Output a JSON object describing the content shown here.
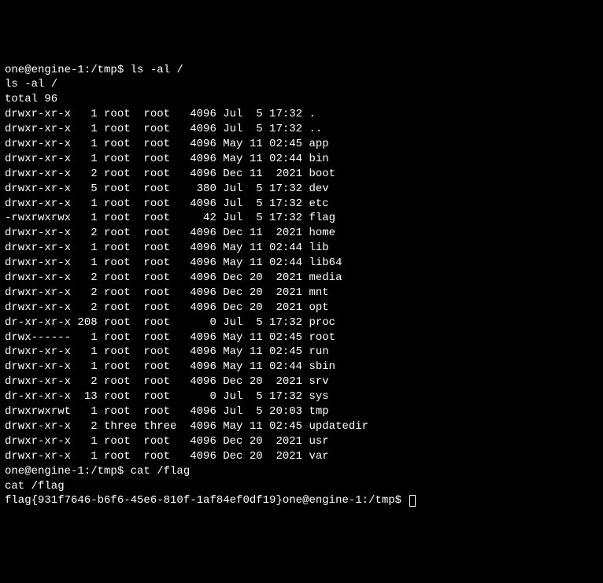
{
  "prompt1": "one@engine-1:/tmp$ ls -al /",
  "echo1": "ls -al /",
  "total_line": "total 96",
  "entries": [
    {
      "perm": "drwxr-xr-x",
      "links": "1",
      "owner": "root",
      "group": "root",
      "size": "4096",
      "month": "Jul",
      "day": "5",
      "time": "17:32",
      "name": "."
    },
    {
      "perm": "drwxr-xr-x",
      "links": "1",
      "owner": "root",
      "group": "root",
      "size": "4096",
      "month": "Jul",
      "day": "5",
      "time": "17:32",
      "name": ".."
    },
    {
      "perm": "drwxr-xr-x",
      "links": "1",
      "owner": "root",
      "group": "root",
      "size": "4096",
      "month": "May",
      "day": "11",
      "time": "02:45",
      "name": "app"
    },
    {
      "perm": "drwxr-xr-x",
      "links": "1",
      "owner": "root",
      "group": "root",
      "size": "4096",
      "month": "May",
      "day": "11",
      "time": "02:44",
      "name": "bin"
    },
    {
      "perm": "drwxr-xr-x",
      "links": "2",
      "owner": "root",
      "group": "root",
      "size": "4096",
      "month": "Dec",
      "day": "11",
      "time": "2021",
      "name": "boot"
    },
    {
      "perm": "drwxr-xr-x",
      "links": "5",
      "owner": "root",
      "group": "root",
      "size": "380",
      "month": "Jul",
      "day": "5",
      "time": "17:32",
      "name": "dev"
    },
    {
      "perm": "drwxr-xr-x",
      "links": "1",
      "owner": "root",
      "group": "root",
      "size": "4096",
      "month": "Jul",
      "day": "5",
      "time": "17:32",
      "name": "etc"
    },
    {
      "perm": "-rwxrwxrwx",
      "links": "1",
      "owner": "root",
      "group": "root",
      "size": "42",
      "month": "Jul",
      "day": "5",
      "time": "17:32",
      "name": "flag"
    },
    {
      "perm": "drwxr-xr-x",
      "links": "2",
      "owner": "root",
      "group": "root",
      "size": "4096",
      "month": "Dec",
      "day": "11",
      "time": "2021",
      "name": "home"
    },
    {
      "perm": "drwxr-xr-x",
      "links": "1",
      "owner": "root",
      "group": "root",
      "size": "4096",
      "month": "May",
      "day": "11",
      "time": "02:44",
      "name": "lib"
    },
    {
      "perm": "drwxr-xr-x",
      "links": "1",
      "owner": "root",
      "group": "root",
      "size": "4096",
      "month": "May",
      "day": "11",
      "time": "02:44",
      "name": "lib64"
    },
    {
      "perm": "drwxr-xr-x",
      "links": "2",
      "owner": "root",
      "group": "root",
      "size": "4096",
      "month": "Dec",
      "day": "20",
      "time": "2021",
      "name": "media"
    },
    {
      "perm": "drwxr-xr-x",
      "links": "2",
      "owner": "root",
      "group": "root",
      "size": "4096",
      "month": "Dec",
      "day": "20",
      "time": "2021",
      "name": "mnt"
    },
    {
      "perm": "drwxr-xr-x",
      "links": "2",
      "owner": "root",
      "group": "root",
      "size": "4096",
      "month": "Dec",
      "day": "20",
      "time": "2021",
      "name": "opt"
    },
    {
      "perm": "dr-xr-xr-x",
      "links": "208",
      "owner": "root",
      "group": "root",
      "size": "0",
      "month": "Jul",
      "day": "5",
      "time": "17:32",
      "name": "proc"
    },
    {
      "perm": "drwx------",
      "links": "1",
      "owner": "root",
      "group": "root",
      "size": "4096",
      "month": "May",
      "day": "11",
      "time": "02:45",
      "name": "root"
    },
    {
      "perm": "drwxr-xr-x",
      "links": "1",
      "owner": "root",
      "group": "root",
      "size": "4096",
      "month": "May",
      "day": "11",
      "time": "02:45",
      "name": "run"
    },
    {
      "perm": "drwxr-xr-x",
      "links": "1",
      "owner": "root",
      "group": "root",
      "size": "4096",
      "month": "May",
      "day": "11",
      "time": "02:44",
      "name": "sbin"
    },
    {
      "perm": "drwxr-xr-x",
      "links": "2",
      "owner": "root",
      "group": "root",
      "size": "4096",
      "month": "Dec",
      "day": "20",
      "time": "2021",
      "name": "srv"
    },
    {
      "perm": "dr-xr-xr-x",
      "links": "13",
      "owner": "root",
      "group": "root",
      "size": "0",
      "month": "Jul",
      "day": "5",
      "time": "17:32",
      "name": "sys"
    },
    {
      "perm": "drwxrwxrwt",
      "links": "1",
      "owner": "root",
      "group": "root",
      "size": "4096",
      "month": "Jul",
      "day": "5",
      "time": "20:03",
      "name": "tmp"
    },
    {
      "perm": "drwxr-xr-x",
      "links": "2",
      "owner": "three",
      "group": "three",
      "size": "4096",
      "month": "May",
      "day": "11",
      "time": "02:45",
      "name": "updatedir"
    },
    {
      "perm": "drwxr-xr-x",
      "links": "1",
      "owner": "root",
      "group": "root",
      "size": "4096",
      "month": "Dec",
      "day": "20",
      "time": "2021",
      "name": "usr"
    },
    {
      "perm": "drwxr-xr-x",
      "links": "1",
      "owner": "root",
      "group": "root",
      "size": "4096",
      "month": "Dec",
      "day": "20",
      "time": "2021",
      "name": "var"
    }
  ],
  "prompt2": "one@engine-1:/tmp$ cat /flag",
  "echo2": "cat /flag",
  "flag_output": "flag{931f7646-b6f6-45e6-810f-1af84ef0df19}",
  "prompt3": "one@engine-1:/tmp$ "
}
